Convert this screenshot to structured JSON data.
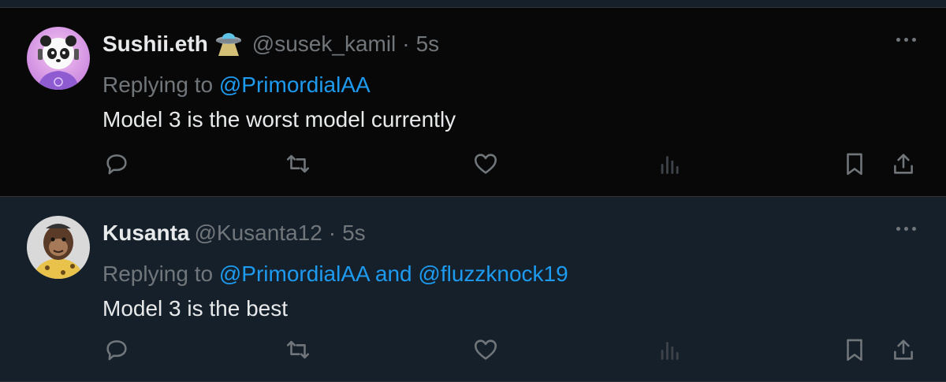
{
  "colors": {
    "text": "#e7e9ea",
    "muted": "#71767b",
    "link": "#1d9bf0",
    "bg_dark": "#080808",
    "bg_dim": "#15202b",
    "border": "#2f3336"
  },
  "tweets": [
    {
      "display_name": "Sushii.eth",
      "badge_icon": "ufo-emoji",
      "handle": "@susek_kamil",
      "separator": "·",
      "time": "5s",
      "replying_prefix": "Replying to ",
      "replying_to": "@PrimordialAA",
      "text": "Model 3 is the worst model currently",
      "avatar_icon": "panda-avatar"
    },
    {
      "display_name": "Kusanta",
      "handle": "@Kusanta12",
      "separator": "·",
      "time": "5s",
      "replying_prefix": "Replying to ",
      "replying_to": "@PrimordialAA and @fluzzknock19",
      "text": "Model 3 is the best",
      "avatar_icon": "ape-avatar"
    }
  ],
  "actions": [
    "reply-icon",
    "retweet-icon",
    "like-icon",
    "views-icon",
    "bookmark-icon",
    "share-icon"
  ]
}
